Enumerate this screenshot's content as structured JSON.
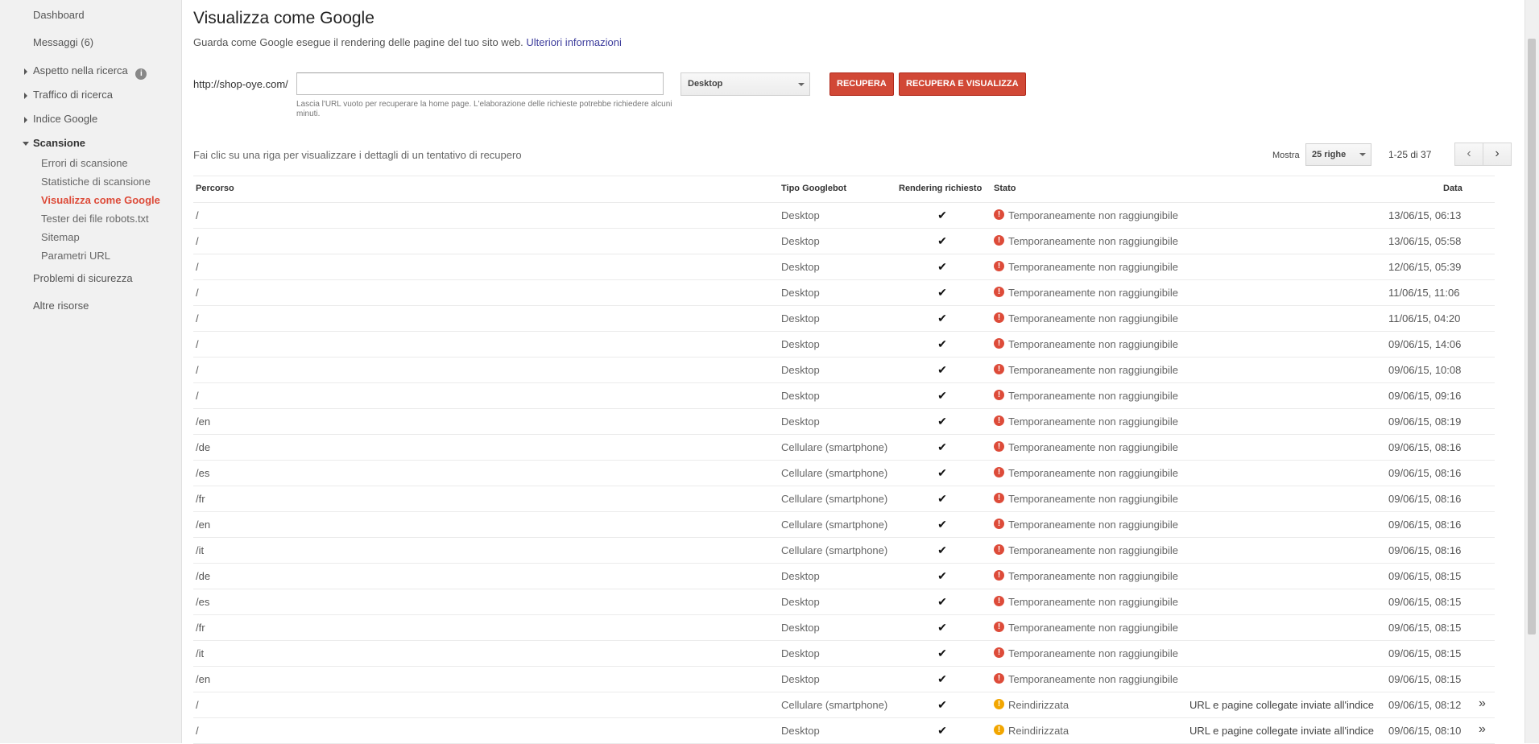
{
  "sidebar": {
    "top_items": [
      {
        "label": "Dashboard"
      },
      {
        "label": "Messaggi (6)"
      }
    ],
    "groups": [
      {
        "label": "Aspetto nella ricerca",
        "has_info": true
      },
      {
        "label": "Traffico di ricerca"
      },
      {
        "label": "Indice Google"
      },
      {
        "label": "Scansione"
      }
    ],
    "crawl_items": [
      {
        "label": "Errori di scansione"
      },
      {
        "label": "Statistiche di scansione"
      },
      {
        "label": "Visualizza come Google",
        "active": true
      },
      {
        "label": "Tester dei file robots.txt"
      },
      {
        "label": "Sitemap"
      },
      {
        "label": "Parametri URL"
      }
    ],
    "bottom_items": [
      {
        "label": "Problemi di sicurezza"
      },
      {
        "label": "Altre risorse"
      }
    ]
  },
  "header": {
    "title": "Visualizza come Google",
    "subtitle": "Guarda come Google esegue il rendering delle pagine del tuo sito web.",
    "more_link": "Ulteriori informazioni"
  },
  "fetch_form": {
    "url_prefix": "http://shop-oye.com/",
    "url_value": "",
    "url_hint": "Lascia l'URL vuoto per recuperare la home page. L'elaborazione delle richieste potrebbe richiedere alcuni minuti.",
    "device_selected": "Desktop",
    "fetch_button": "RECUPERA",
    "fetch_render_button": "RECUPERA E VISUALIZZA"
  },
  "list_controls": {
    "hint": "Fai clic su una riga per visualizzare i dettagli di un tentativo di recupero",
    "show_label": "Mostra",
    "rows_selected": "25 righe",
    "pager_text": "1-25 di 37",
    "prev_glyph": "‹",
    "next_glyph": "›"
  },
  "table": {
    "headers": {
      "path": "Percorso",
      "bot": "Tipo Googlebot",
      "render": "Rendering richiesto",
      "status": "Stato",
      "date": "Data"
    },
    "check_glyph": "✔",
    "go_glyph": "»",
    "rows": [
      {
        "path": "/",
        "bot": "Desktop",
        "status_type": "err",
        "status": "Temporaneamente non raggiungibile",
        "extra": "",
        "date": "13/06/15, 06:13"
      },
      {
        "path": "/",
        "bot": "Desktop",
        "status_type": "err",
        "status": "Temporaneamente non raggiungibile",
        "extra": "",
        "date": "13/06/15, 05:58"
      },
      {
        "path": "/",
        "bot": "Desktop",
        "status_type": "err",
        "status": "Temporaneamente non raggiungibile",
        "extra": "",
        "date": "12/06/15, 05:39"
      },
      {
        "path": "/",
        "bot": "Desktop",
        "status_type": "err",
        "status": "Temporaneamente non raggiungibile",
        "extra": "",
        "date": "11/06/15, 11:06"
      },
      {
        "path": "/",
        "bot": "Desktop",
        "status_type": "err",
        "status": "Temporaneamente non raggiungibile",
        "extra": "",
        "date": "11/06/15, 04:20"
      },
      {
        "path": "/",
        "bot": "Desktop",
        "status_type": "err",
        "status": "Temporaneamente non raggiungibile",
        "extra": "",
        "date": "09/06/15, 14:06"
      },
      {
        "path": "/",
        "bot": "Desktop",
        "status_type": "err",
        "status": "Temporaneamente non raggiungibile",
        "extra": "",
        "date": "09/06/15, 10:08"
      },
      {
        "path": "/",
        "bot": "Desktop",
        "status_type": "err",
        "status": "Temporaneamente non raggiungibile",
        "extra": "",
        "date": "09/06/15, 09:16"
      },
      {
        "path": "/en",
        "bot": "Desktop",
        "status_type": "err",
        "status": "Temporaneamente non raggiungibile",
        "extra": "",
        "date": "09/06/15, 08:19"
      },
      {
        "path": "/de",
        "bot": "Cellulare (smartphone)",
        "status_type": "err",
        "status": "Temporaneamente non raggiungibile",
        "extra": "",
        "date": "09/06/15, 08:16"
      },
      {
        "path": "/es",
        "bot": "Cellulare (smartphone)",
        "status_type": "err",
        "status": "Temporaneamente non raggiungibile",
        "extra": "",
        "date": "09/06/15, 08:16"
      },
      {
        "path": "/fr",
        "bot": "Cellulare (smartphone)",
        "status_type": "err",
        "status": "Temporaneamente non raggiungibile",
        "extra": "",
        "date": "09/06/15, 08:16"
      },
      {
        "path": "/en",
        "bot": "Cellulare (smartphone)",
        "status_type": "err",
        "status": "Temporaneamente non raggiungibile",
        "extra": "",
        "date": "09/06/15, 08:16"
      },
      {
        "path": "/it",
        "bot": "Cellulare (smartphone)",
        "status_type": "err",
        "status": "Temporaneamente non raggiungibile",
        "extra": "",
        "date": "09/06/15, 08:16"
      },
      {
        "path": "/de",
        "bot": "Desktop",
        "status_type": "err",
        "status": "Temporaneamente non raggiungibile",
        "extra": "",
        "date": "09/06/15, 08:15"
      },
      {
        "path": "/es",
        "bot": "Desktop",
        "status_type": "err",
        "status": "Temporaneamente non raggiungibile",
        "extra": "",
        "date": "09/06/15, 08:15"
      },
      {
        "path": "/fr",
        "bot": "Desktop",
        "status_type": "err",
        "status": "Temporaneamente non raggiungibile",
        "extra": "",
        "date": "09/06/15, 08:15"
      },
      {
        "path": "/it",
        "bot": "Desktop",
        "status_type": "err",
        "status": "Temporaneamente non raggiungibile",
        "extra": "",
        "date": "09/06/15, 08:15"
      },
      {
        "path": "/en",
        "bot": "Desktop",
        "status_type": "err",
        "status": "Temporaneamente non raggiungibile",
        "extra": "",
        "date": "09/06/15, 08:15"
      },
      {
        "path": "/",
        "bot": "Cellulare (smartphone)",
        "status_type": "warn",
        "status": "Reindirizzata",
        "extra": "URL e pagine collegate inviate all'indice",
        "date": "09/06/15, 08:12",
        "has_go": true
      },
      {
        "path": "/",
        "bot": "Desktop",
        "status_type": "warn",
        "status": "Reindirizzata",
        "extra": "URL e pagine collegate inviate all'indice",
        "date": "09/06/15, 08:10",
        "has_go": true
      }
    ]
  },
  "colors": {
    "accent_red": "#d14836",
    "active_nav": "#dd4b39",
    "error_icon": "#dd4b39",
    "warning_icon": "#f2a600"
  }
}
